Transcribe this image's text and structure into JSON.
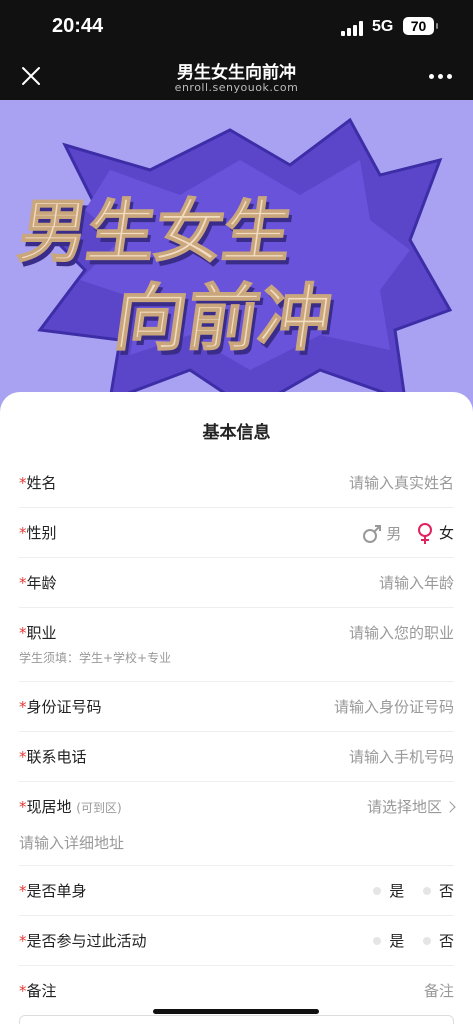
{
  "status_bar": {
    "time": "20:44",
    "network": "5G",
    "battery": "70"
  },
  "nav": {
    "title": "男生女生向前冲",
    "url": "enroll.senyouok.com"
  },
  "banner": {
    "line1": "男生女生",
    "line2": "向前冲",
    "colors": {
      "bg": "#a9a2f2",
      "star": "#5b46c9",
      "text": "#f2dcc0"
    }
  },
  "form": {
    "title": "基本信息",
    "required_mark": "*",
    "name": {
      "label": "姓名",
      "placeholder": "请输入真实姓名"
    },
    "gender": {
      "label": "性别",
      "male": "男",
      "female": "女",
      "selected": "女"
    },
    "age": {
      "label": "年龄",
      "placeholder": "请输入年龄"
    },
    "job": {
      "label": "职业",
      "placeholder": "请输入您的职业",
      "hint": "学生须填：学生+学校+专业"
    },
    "id": {
      "label": "身份证号码",
      "placeholder": "请输入身份证号码"
    },
    "phone": {
      "label": "联系电话",
      "placeholder": "请输入手机号码"
    },
    "address": {
      "label": "现居地",
      "label_hint": "(可到区)",
      "placeholder": "请选择地区",
      "detail_placeholder": "请输入详细地址"
    },
    "single": {
      "label": "是否单身",
      "yes": "是",
      "no": "否"
    },
    "participated": {
      "label": "是否参与过此活动",
      "yes": "是",
      "no": "否"
    },
    "notes": {
      "label": "备注",
      "placeholder": "备注"
    }
  }
}
